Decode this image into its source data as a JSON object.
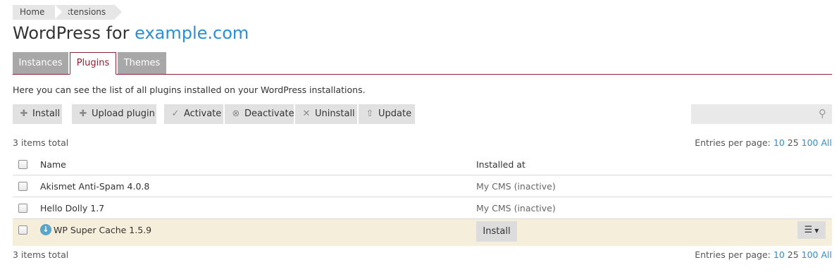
{
  "breadcrumb": [
    "Home",
    "Extensions"
  ],
  "title": {
    "prefix": "WordPress for ",
    "domain": "example.com"
  },
  "tabs": [
    {
      "label": "Instances",
      "active": false
    },
    {
      "label": "Plugins",
      "active": true
    },
    {
      "label": "Themes",
      "active": false
    }
  ],
  "description": "Here you can see the list of all plugins installed on your WordPress installations.",
  "toolbar": {
    "install": "Install",
    "upload": "Upload plugin",
    "activate": "Activate",
    "deactivate": "Deactivate",
    "uninstall": "Uninstall",
    "update": "Update"
  },
  "search": {
    "placeholder": ""
  },
  "summary": {
    "total": "3 items total"
  },
  "pagination": {
    "label": "Entries per page:",
    "options": [
      "10",
      "25",
      "100",
      "All"
    ],
    "selected": "25"
  },
  "table": {
    "headers": {
      "name": "Name",
      "installed_at": "Installed at"
    },
    "rows": [
      {
        "name": "Akismet Anti-Spam 4.0.8",
        "installed_at": "My CMS (inactive)"
      },
      {
        "name": "Hello Dolly 1.7",
        "installed_at": "My CMS (inactive)"
      },
      {
        "name": "WP Super Cache 1.5.9",
        "installed_at": "",
        "action": "Install",
        "status_icon": "download-icon",
        "highlighted": true
      }
    ]
  },
  "colors": {
    "accent": "#8a2432",
    "link": "#2b8fd2",
    "highlight_row": "#f5eedb"
  }
}
